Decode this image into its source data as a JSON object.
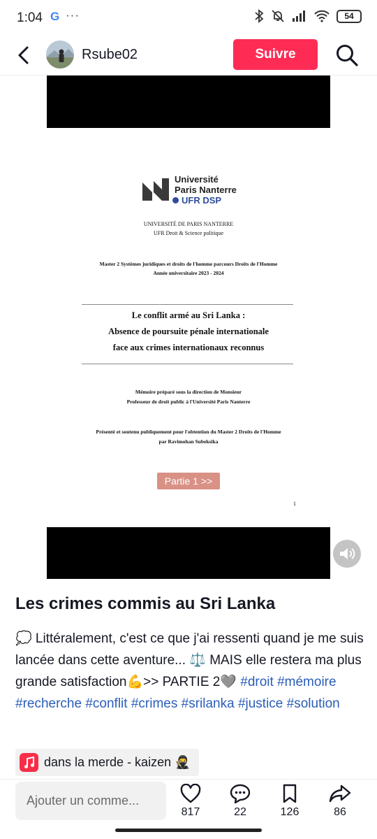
{
  "status_bar": {
    "time": "1:04",
    "battery": "54",
    "left_icons": [
      "google-icon",
      "more-dots-icon"
    ],
    "right_icons": [
      "bluetooth-icon",
      "mute-icon",
      "signal-icon",
      "wifi-icon",
      "battery-icon"
    ]
  },
  "header": {
    "username": "Rsube02",
    "follow_label": "Suivre"
  },
  "document": {
    "logo_line1": "Université",
    "logo_line2": "Paris Nanterre",
    "logo_line3": "UFR DSP",
    "university": "UNIVERSITÉ DE PARIS NANTERRE",
    "ufr": "UFR Droit & Science politique",
    "master": "Master 2 Systèmes juridiques et droits de l'homme parcours Droits de l'Homme",
    "year": "Année universitaire 2023 - 2024",
    "title_line1": "Le conflit armé au Sri Lanka :",
    "title_line2": "Absence de poursuite pénale internationale",
    "title_line3": "face aux crimes internationaux reconnus",
    "memoire": "Mémoire préparé sous la direction de Monsieur",
    "professor": "Professeur de droit public à l'Université Paris Nanterre",
    "presented": "Présenté et soutenu publiquement pour l'obtention du Master 2 Droits de l'Homme",
    "author": "par Ravimohan Subeksika",
    "partie_label": "Partie 1 >>",
    "page_number": "1"
  },
  "post": {
    "title": "Les crimes commis au Sri Lanka",
    "caption_text": "💭 Littéralement, c'est ce que j'ai ressenti quand je me suis lancée dans cette aventure... ⚖️ MAIS elle restera ma plus grande satisfaction💪>> PARTIE 2🩶",
    "hashtags": [
      "#droit",
      "#mémoire",
      "#recherche",
      "#conflit",
      "#crimes",
      "#srilanka",
      "#justice",
      "#solution"
    ],
    "music": "dans la merde - kaizen 🥷"
  },
  "bottom_bar": {
    "comment_placeholder": "Ajouter un comme...",
    "likes": "817",
    "comments": "22",
    "saves": "126",
    "shares": "86"
  },
  "colors": {
    "follow_button": "#fe2c55",
    "hashtag": "#2b5db9",
    "partie_button": "#d99186",
    "music_icon": "#fa2d48"
  }
}
